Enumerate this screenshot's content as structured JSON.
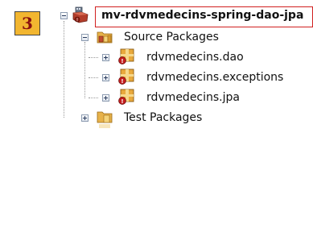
{
  "step_badge": "3",
  "tree": {
    "project": {
      "label": "mv-rdvmedecins-spring-dao-jpa",
      "icon": "maven-project-icon",
      "expanded": true
    },
    "source_packages": {
      "label": "Source Packages",
      "icon": "source-folder-icon",
      "expanded": true,
      "packages": [
        {
          "label": "rdvmedecins.dao",
          "icon": "package-error-icon",
          "expanded": false
        },
        {
          "label": "rdvmedecins.exceptions",
          "icon": "package-error-icon",
          "expanded": false
        },
        {
          "label": "rdvmedecins.jpa",
          "icon": "package-error-icon",
          "expanded": false
        }
      ]
    },
    "test_packages": {
      "label": "Test Packages",
      "icon": "test-folder-icon",
      "expanded": false
    }
  },
  "colors": {
    "badge_bg": "#f2b630",
    "badge_text": "#8a1010",
    "highlight_border": "#d12020"
  }
}
